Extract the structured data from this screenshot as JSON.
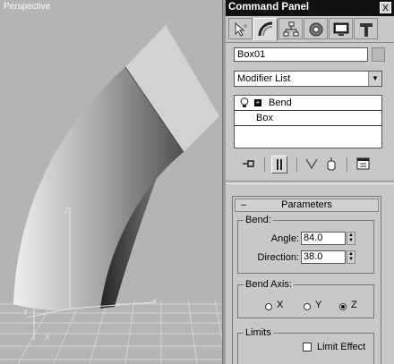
{
  "viewport": {
    "label": "Perspective"
  },
  "panel": {
    "title": "Command Panel",
    "close_label": "X",
    "tabs": [
      {
        "name": "create",
        "icon": "create-pointer-icon"
      },
      {
        "name": "modify",
        "icon": "modify-arc-icon"
      },
      {
        "name": "hierarchy",
        "icon": "hierarchy-icon"
      },
      {
        "name": "motion",
        "icon": "motion-icon"
      },
      {
        "name": "display",
        "icon": "display-monitor-icon"
      },
      {
        "name": "utilities",
        "icon": "utilities-hammer-icon"
      }
    ],
    "object_name": "Box01",
    "modifier_list": "Modifier List",
    "stack": [
      {
        "label": "Bend",
        "expander": "+"
      },
      {
        "label": "Box"
      }
    ],
    "rollout": {
      "collapse_symbol": "–",
      "title": "Parameters",
      "bend": {
        "group_title": "Bend:",
        "angle_label": "Angle:",
        "angle_value": "84.0",
        "direction_label": "Direction:",
        "direction_value": "38.0"
      },
      "bend_axis": {
        "group_title": "Bend Axis:",
        "options": [
          "X",
          "Y",
          "Z"
        ],
        "selected": "Z"
      },
      "limits": {
        "group_title": "Limits",
        "limit_effect_label": "Limit Effect",
        "limit_effect_checked": false
      }
    }
  }
}
